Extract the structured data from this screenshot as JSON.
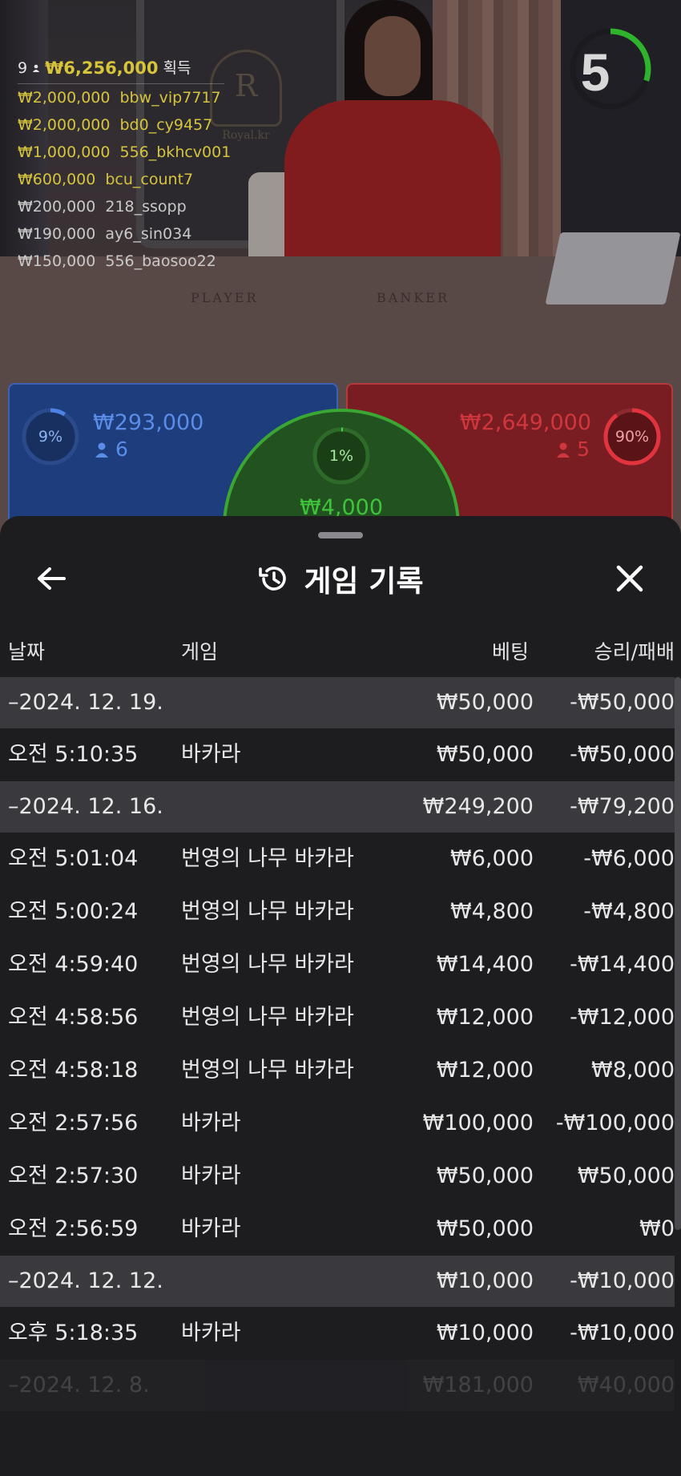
{
  "stream": {
    "logo_letter": "R",
    "logo_caption": "Royal.kr",
    "table_left_label": "PLAYER",
    "table_right_label": "BANKER",
    "countdown": "5",
    "countdown_fraction": 0.3
  },
  "winners": {
    "count": "9",
    "total": "₩6,256,000",
    "total_suffix": "획득",
    "rows": [
      {
        "amount": "₩2,000,000",
        "name": "bbw_vip7717"
      },
      {
        "amount": "₩2,000,000",
        "name": "bd0_cy9457"
      },
      {
        "amount": "₩1,000,000",
        "name": "556_bkhcv001"
      },
      {
        "amount": "₩600,000",
        "name": "bcu_count7"
      },
      {
        "amount": "₩200,000",
        "name": "218_ssopp"
      },
      {
        "amount": "₩190,000",
        "name": "ay6_sin034"
      },
      {
        "amount": "₩150,000",
        "name": "556_baosoo22"
      }
    ]
  },
  "bets": {
    "player": {
      "percent": "9%",
      "percent_value": 9,
      "amount": "₩293,000",
      "count": "6"
    },
    "tie": {
      "percent": "1%",
      "percent_value": 1,
      "amount": "₩4,000"
    },
    "banker": {
      "percent": "90%",
      "percent_value": 90,
      "amount": "₩2,649,000",
      "count": "5"
    }
  },
  "sheet": {
    "title": "게임 기록",
    "columns": {
      "date": "날짜",
      "game": "게임",
      "bet": "베팅",
      "result": "승리/패배"
    },
    "rows": [
      {
        "type": "date",
        "date": "–2024. 12. 19.",
        "game": "",
        "bet": "₩50,000",
        "result": "-₩50,000"
      },
      {
        "type": "item",
        "date": "오전 5:10:35",
        "game": "바카라",
        "bet": "₩50,000",
        "result": "-₩50,000"
      },
      {
        "type": "date",
        "date": "–2024. 12. 16.",
        "game": "",
        "bet": "₩249,200",
        "result": "-₩79,200"
      },
      {
        "type": "item",
        "date": "오전 5:01:04",
        "game": "번영의 나무 바카라",
        "bet": "₩6,000",
        "result": "-₩6,000"
      },
      {
        "type": "item",
        "date": "오전 5:00:24",
        "game": "번영의 나무 바카라",
        "bet": "₩4,800",
        "result": "-₩4,800"
      },
      {
        "type": "item",
        "date": "오전 4:59:40",
        "game": "번영의 나무 바카라",
        "bet": "₩14,400",
        "result": "-₩14,400"
      },
      {
        "type": "item",
        "date": "오전 4:58:56",
        "game": "번영의 나무 바카라",
        "bet": "₩12,000",
        "result": "-₩12,000"
      },
      {
        "type": "item",
        "date": "오전 4:58:18",
        "game": "번영의 나무 바카라",
        "bet": "₩12,000",
        "result": "₩8,000"
      },
      {
        "type": "item",
        "date": "오전 2:57:56",
        "game": "바카라",
        "bet": "₩100,000",
        "result": "-₩100,000"
      },
      {
        "type": "item",
        "date": "오전 2:57:30",
        "game": "바카라",
        "bet": "₩50,000",
        "result": "₩50,000"
      },
      {
        "type": "item",
        "date": "오전 2:56:59",
        "game": "바카라",
        "bet": "₩50,000",
        "result": "₩0"
      },
      {
        "type": "date",
        "date": "–2024. 12. 12.",
        "game": "",
        "bet": "₩10,000",
        "result": "-₩10,000"
      },
      {
        "type": "item",
        "date": "오후 5:18:35",
        "game": "바카라",
        "bet": "₩10,000",
        "result": "-₩10,000"
      },
      {
        "type": "date",
        "date": "–2024. 12. 8.",
        "game": "",
        "bet": "₩181,000",
        "result": "₩40,000"
      }
    ]
  },
  "colors": {
    "player": "#2c5bb5",
    "banker": "#c2323a",
    "tie": "#3aa633",
    "gold_text": "#d6c43e",
    "sheet_bg": "#1d1d20",
    "date_row_bg": "#3a3a3e"
  }
}
